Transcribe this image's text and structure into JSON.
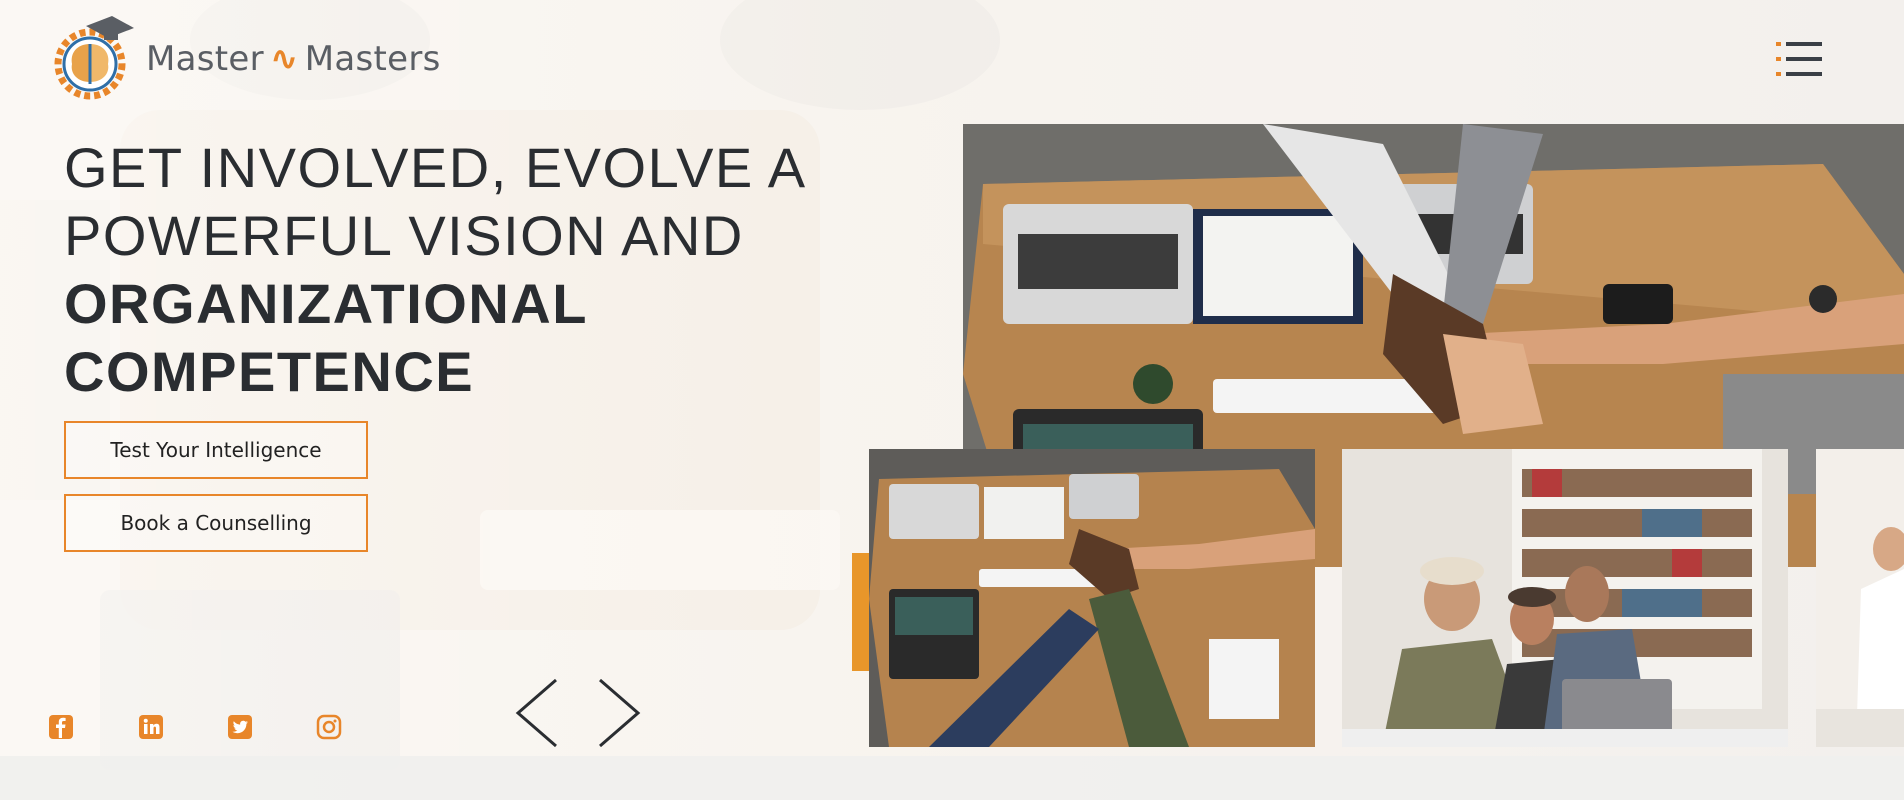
{
  "brand": {
    "name_left": "Master",
    "name_joiner": "∿",
    "name_right": "Masters",
    "accent_color": "#e8862a",
    "text_color": "#5a5e64"
  },
  "header": {
    "menu_icon": "hamburger-list-icon"
  },
  "hero": {
    "line1": "GET INVOLVED, EVOLVE A",
    "line2": "POWERFUL VISION AND",
    "line3": "ORGANIZATIONAL",
    "line4": "COMPETENCE"
  },
  "buttons": {
    "test_label": "Test Your Intelligence",
    "book_label": "Book a Counselling"
  },
  "social": [
    {
      "icon": "facebook-icon"
    },
    {
      "icon": "linkedin-icon"
    },
    {
      "icon": "twitter-icon"
    },
    {
      "icon": "instagram-icon"
    }
  ],
  "carousel": {
    "prev_icon": "chevron-left-icon",
    "next_icon": "chevron-right-icon"
  },
  "images": {
    "main": "team hands stacked on wooden desk with laptops",
    "slide1": "team hands stacked over desk",
    "slide2": "smiling team working at laptop in library",
    "slide3": "person in white shirt"
  }
}
